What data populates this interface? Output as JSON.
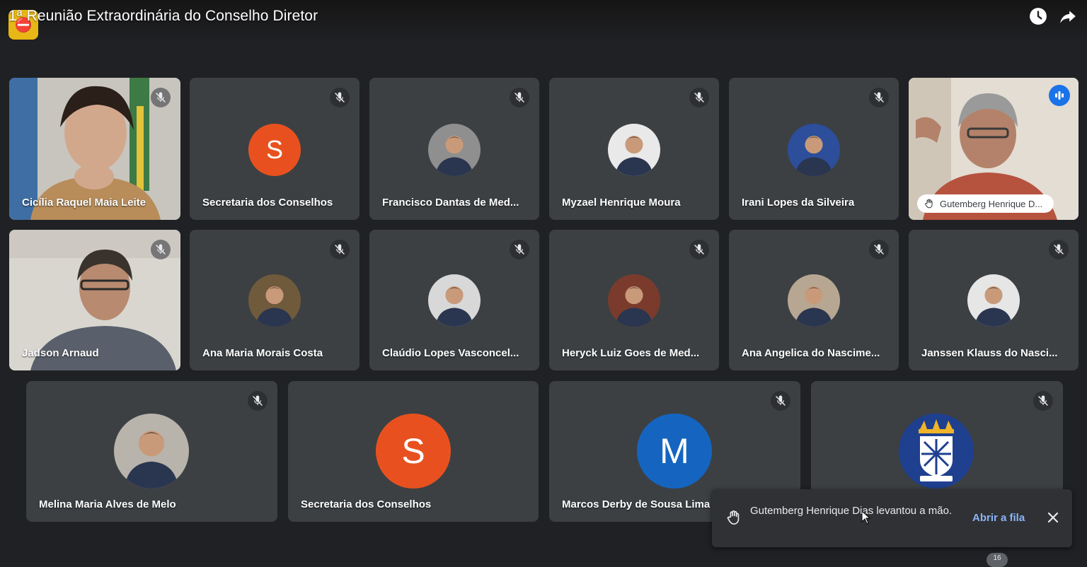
{
  "window": {
    "title": "1ª Reunião Extraordinária do Conselho Diretor"
  },
  "colors": {
    "background": "#202124",
    "tile": "#3c4043",
    "accent": "#8ab4f8",
    "speaking_badge": "#1a73e8",
    "avatar_orange": "#e8511f",
    "avatar_blue": "#1565c0"
  },
  "participants": {
    "row1": [
      {
        "name": "Cicília Raquel Maia Leite",
        "kind": "video",
        "mic": "muted"
      },
      {
        "name": "Secretaria dos Conselhos",
        "kind": "letter",
        "initial": "S",
        "mic": "muted"
      },
      {
        "name": "Francisco Dantas de Med...",
        "kind": "photo",
        "mic": "muted"
      },
      {
        "name": "Myzael Henrique Moura",
        "kind": "photo",
        "mic": "muted"
      },
      {
        "name": "Irani Lopes da Silveira",
        "kind": "photo",
        "mic": "muted"
      },
      {
        "name": "Gutemberg Henrique D...",
        "kind": "video",
        "mic": "speaking"
      }
    ],
    "row2": [
      {
        "name": "Jadson Arnaud",
        "kind": "video",
        "mic": "muted"
      },
      {
        "name": "Ana Maria Morais Costa",
        "kind": "photo",
        "mic": "muted"
      },
      {
        "name": "Claúdio Lopes Vasconcel...",
        "kind": "photo",
        "mic": "muted"
      },
      {
        "name": "Heryck Luiz Goes de Med...",
        "kind": "photo",
        "mic": "muted"
      },
      {
        "name": "Ana Angelica do Nascime...",
        "kind": "photo",
        "mic": "muted"
      },
      {
        "name": "Janssen Klauss do Nasci...",
        "kind": "photo",
        "mic": "muted"
      }
    ],
    "row3": [
      {
        "name": "Melina Maria Alves de Melo",
        "kind": "photo",
        "mic": "muted"
      },
      {
        "name": "Secretaria dos Conselhos",
        "kind": "letter",
        "initial": "S",
        "mic": "muted"
      },
      {
        "name": "Marcos Derby de Sousa Lima",
        "kind": "letter",
        "initial": "M",
        "mic": "muted"
      },
      {
        "name": "",
        "kind": "emblem",
        "mic": "muted"
      }
    ]
  },
  "notification": {
    "message": "Gutemberg Henrique Dias levantou a mão.",
    "action_label": "Abrir a fila",
    "icon": "raised-hand-icon"
  },
  "participant_count": "16"
}
